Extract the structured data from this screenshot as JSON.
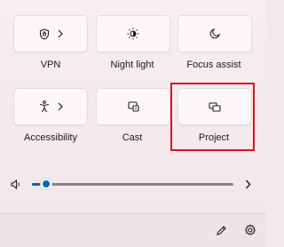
{
  "tiles": [
    {
      "label": "VPN",
      "icon": "shield-icon",
      "has_chevron": true
    },
    {
      "label": "Night light",
      "icon": "brightness-icon",
      "has_chevron": false
    },
    {
      "label": "Focus assist",
      "icon": "moon-icon",
      "has_chevron": false
    },
    {
      "label": "Accessibility",
      "icon": "accessibility-icon",
      "has_chevron": true
    },
    {
      "label": "Cast",
      "icon": "cast-icon",
      "has_chevron": false
    },
    {
      "label": "Project",
      "icon": "project-icon",
      "has_chevron": false
    }
  ],
  "volume": {
    "icon": "speaker-icon",
    "level_fraction": 0.07,
    "expand_icon": "chevron-right-icon"
  },
  "footer": {
    "edit_icon": "pencil-icon",
    "settings_icon": "gear-icon"
  },
  "colors": {
    "accent": "#0067c0",
    "highlight": "#d9141c",
    "panel": "#f4e9ec"
  }
}
